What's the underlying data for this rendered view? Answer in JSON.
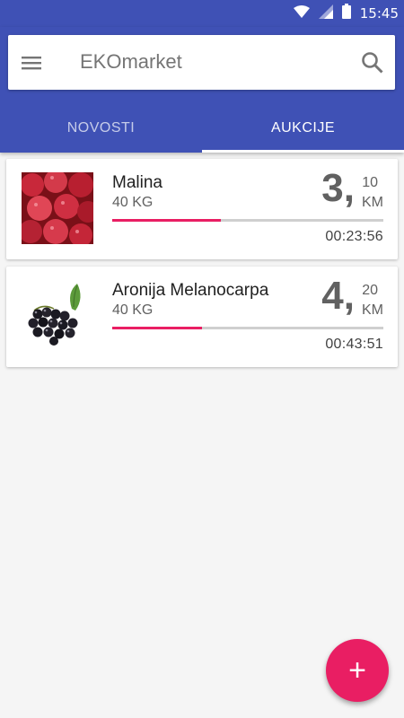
{
  "status_bar": {
    "time": "15:45",
    "icons": [
      "wifi-icon",
      "signal-icon",
      "battery-icon"
    ]
  },
  "app": {
    "title": "EKOmarket",
    "menu_icon": "menu-icon",
    "search_icon": "search-icon"
  },
  "tabs": [
    {
      "label": "NOVOSTI",
      "active": false
    },
    {
      "label": "AUKCIJE",
      "active": true
    }
  ],
  "auctions": [
    {
      "name": "Malina",
      "qty": "40 KG",
      "price_main": "3,",
      "price_dec": "10",
      "currency": "KM",
      "progress": 0.4,
      "timer": "00:23:56",
      "image": "raspberries"
    },
    {
      "name": "Aronija Melanocarpa",
      "qty": "40 KG",
      "price_main": "4,",
      "price_dec": "20",
      "currency": "KM",
      "progress": 0.33,
      "timer": "00:43:51",
      "image": "aronia-berries"
    }
  ],
  "fab": {
    "label": "+",
    "icon": "add-icon"
  },
  "colors": {
    "primary": "#3f51b5",
    "accent": "#e91e63",
    "background": "#f5f5f5"
  }
}
